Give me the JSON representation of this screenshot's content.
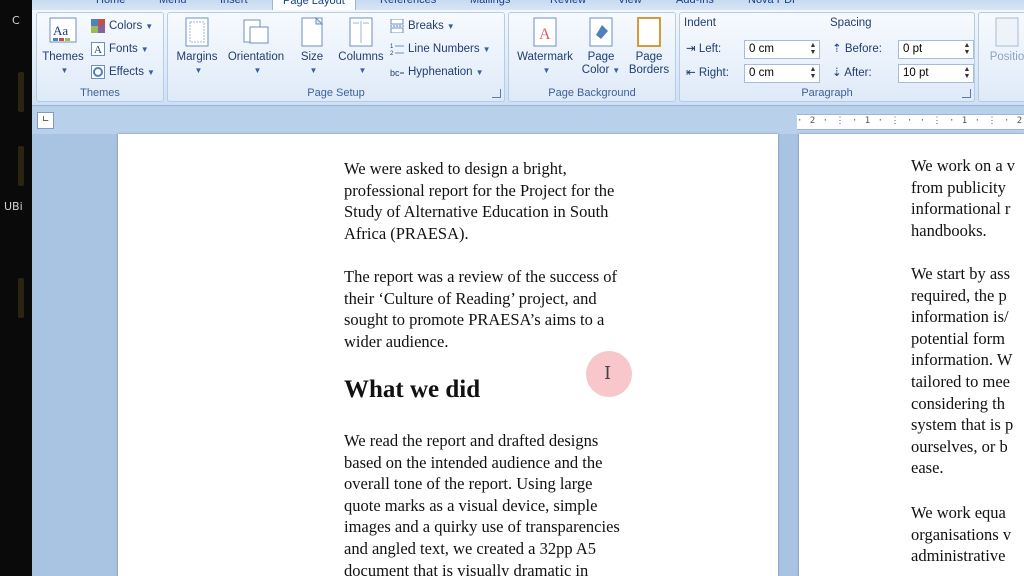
{
  "desktop": {
    "label_top": "C",
    "label_mid": "UBi"
  },
  "tabs": [
    {
      "label": "Home"
    },
    {
      "label": "Menu"
    },
    {
      "label": "Insert"
    },
    {
      "label": "Page Layout"
    },
    {
      "label": "References"
    },
    {
      "label": "Mailings"
    },
    {
      "label": "Review"
    },
    {
      "label": "View"
    },
    {
      "label": "Add-Ins"
    },
    {
      "label": "Nova PDF"
    }
  ],
  "ribbon": {
    "themes": {
      "title": "Themes",
      "themes_btn": "Themes",
      "colors": "Colors",
      "fonts": "Fonts",
      "effects": "Effects"
    },
    "page_setup": {
      "title": "Page Setup",
      "margins": "Margins",
      "orientation": "Orientation",
      "size": "Size",
      "columns": "Columns",
      "breaks": "Breaks",
      "line_numbers": "Line Numbers",
      "hyphenation": "Hyphenation"
    },
    "page_background": {
      "title": "Page Background",
      "watermark": "Watermark",
      "page_color_1": "Page",
      "page_color_2": "Color",
      "page_borders_1": "Page",
      "page_borders_2": "Borders"
    },
    "paragraph": {
      "title": "Paragraph",
      "indent_label": "Indent",
      "spacing_label": "Spacing",
      "left_label": "Left:",
      "left_value": "0 cm",
      "right_label": "Right:",
      "right_value": "0 cm",
      "before_label": "Before:",
      "before_value": "0 pt",
      "after_label": "After:",
      "after_value": "10 pt"
    },
    "arrange": {
      "position": "Positio"
    }
  },
  "ruler": {
    "text": "· 2 · ⋮ · 1 · ⋮ ·   · ⋮ · 1 · ⋮ · 2 · ⋮"
  },
  "page1": {
    "p1": "We were asked to design a bright,\nprofessional report for the Project for the\nStudy of Alternative Education in South\nAfrica (PRAESA).",
    "p2": "The report was a review of the success of\ntheir ‘Culture of Reading’ project, and\nsought to promote PRAESA’s aims to a\nwider audience.",
    "heading": "What we did",
    "p3": "We read the report and drafted designs\nbased on the intended audience and the\noverall tone of the report. Using large\nquote marks as a visual device, simple\nimages and a quirky use of transparencies\nand angled text, we created a 32pp A5\ndocument that is visually dramatic in"
  },
  "page2": {
    "p1": "We work on a v\nfrom publicity\ninformational r\nhandbooks.",
    "p2": "We start by ass\nrequired, the p\ninformation is/\npotential form\ninformation. W\ntailored to mee\nconsidering th\nsystem that is p\nourselves, or b\nease.",
    "p3": "We work equa\norganisations v\nadministrative\n"
  },
  "colors": {
    "ribbon_text": "#1f3e73",
    "doc_background": "#a9c3e3",
    "cursor_highlight": "#f0828c"
  }
}
